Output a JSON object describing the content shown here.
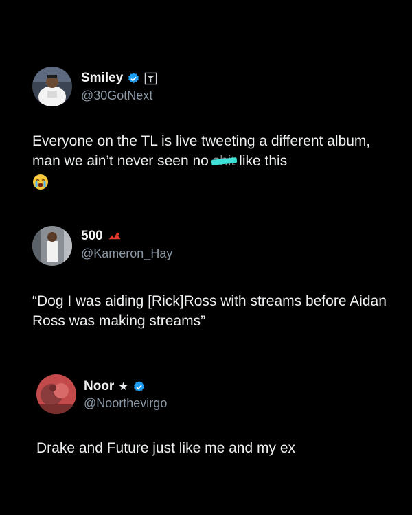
{
  "tweets": [
    {
      "name": "Smiley",
      "handle": "@30GotNext",
      "text_before": "Everyone on the TL is live tweeting a different album, man we ain’t never seen no ",
      "censored_word": "shit",
      "text_after": " like this",
      "emoji": "loudly-crying-face-emoji",
      "badges": [
        "verified-badge-icon",
        "flag-pennant-icon"
      ]
    },
    {
      "name": "500",
      "handle": "@Kameron_Hay",
      "text": "“Dog I was aiding [Rick]Ross with streams before Aidan Ross was making streams”",
      "badges": [
        "decorative-emblem-icon"
      ]
    },
    {
      "name": "Noor",
      "handle": "@Noorthevirgo",
      "text": "Drake and Future just like me and my ex",
      "badges": [
        "star-icon",
        "verified-badge-icon"
      ]
    }
  ],
  "colors": {
    "background": "#000000",
    "verified": "#1d9bf0",
    "handle": "#8b98a5",
    "censor": "#3ee0d8"
  }
}
